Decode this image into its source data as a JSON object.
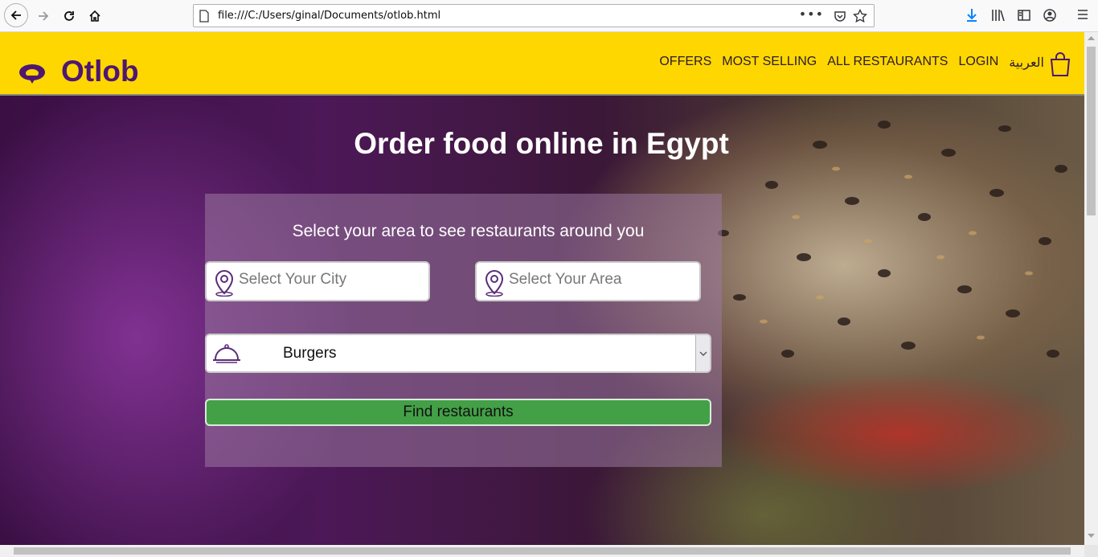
{
  "browser": {
    "url": "file:///C:/Users/ginal/Documents/otlob.html",
    "url_actions_label": "•••"
  },
  "header": {
    "logo_text": "Otlob",
    "nav": [
      {
        "label": "OFFERS"
      },
      {
        "label": "MOST SELLING"
      },
      {
        "label": "ALL RESTAURANTS"
      },
      {
        "label": "LOGIN"
      },
      {
        "label": "العربية"
      }
    ],
    "brand_color": "#fed700",
    "accent_color": "#4e1770"
  },
  "hero": {
    "title": "Order food online in Egypt"
  },
  "search_panel": {
    "heading": "Select your area to see restaurants around you",
    "city_placeholder": "Select Your City",
    "area_placeholder": "Select Your Area",
    "cuisine_selected": "Burgers",
    "find_button": "Find restaurants",
    "button_color": "#43a047"
  }
}
